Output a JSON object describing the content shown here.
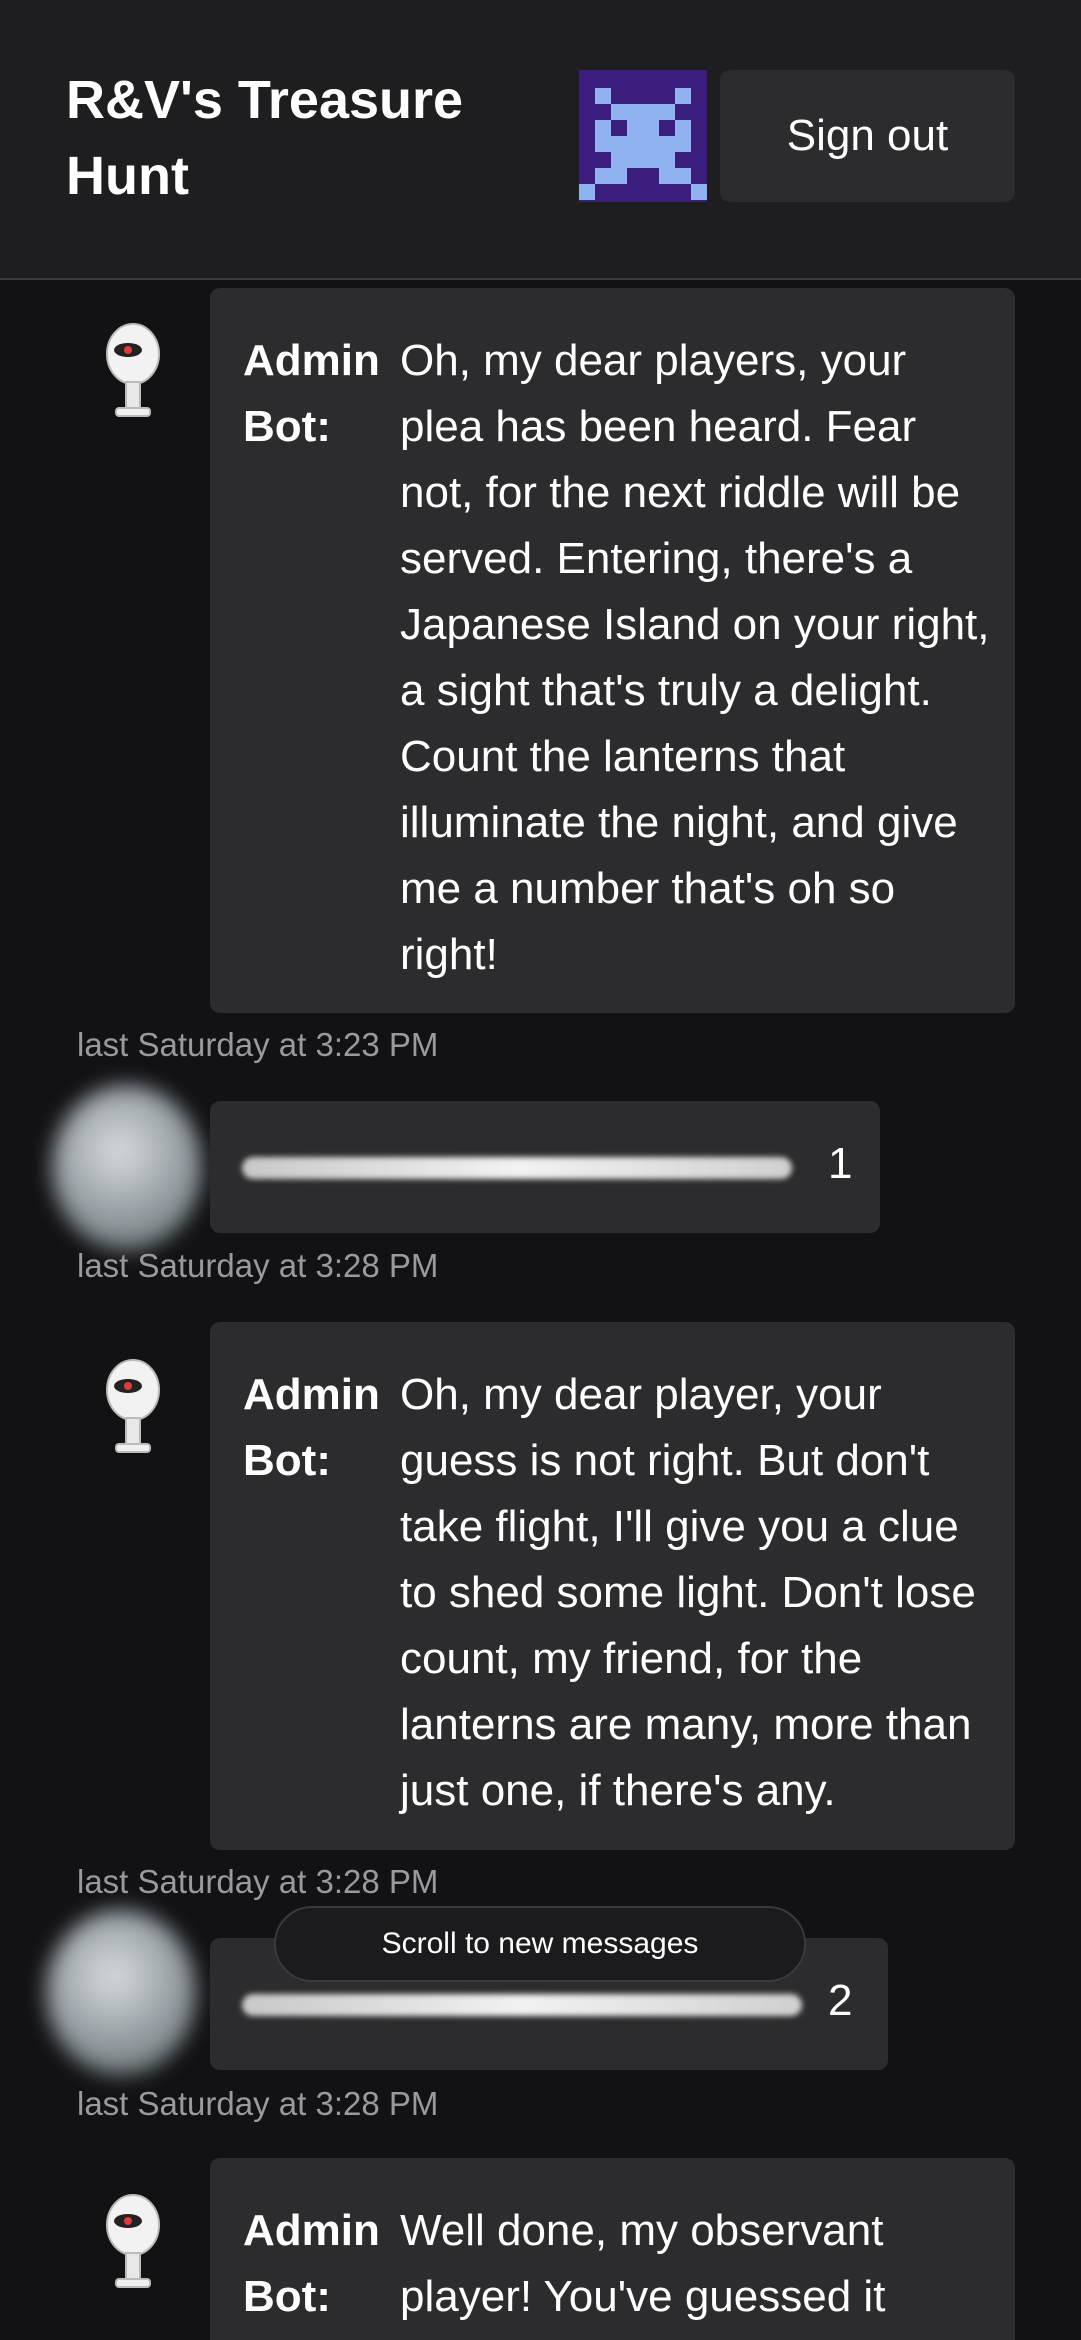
{
  "header": {
    "title": "R&V's Treasure Hunt",
    "signout_label": "Sign out"
  },
  "messages": [
    {
      "sender": "Admin Bot:",
      "text": "Oh, my dear players, your plea has been heard. Fear not, for the next riddle will be served. Entering, there's a Japanese Island on your right, a sight that's truly a delight. Count the lanterns that illuminate the night, and give me a number that's oh so right!",
      "timestamp": "last Saturday at 3:23 PM"
    },
    {
      "answer": "1",
      "timestamp": "last Saturday at 3:28 PM"
    },
    {
      "sender": "Admin Bot:",
      "text": "Oh, my dear player, your guess is not right. But don't take flight, I'll give you a clue to shed some light. Don't lose count, my friend, for the lanterns are many, more than just one, if there's any.",
      "timestamp": "last Saturday at 3:28 PM"
    },
    {
      "answer": "2",
      "timestamp": "last Saturday at 3:28 PM"
    },
    {
      "sender": "Admin Bot:",
      "text": "Well done, my observant player! You've guessed it"
    }
  ],
  "scroll_pill": "Scroll to new messages",
  "icons": {
    "avatar": "pixel-invader-icon",
    "bot": "robot-avatar-icon"
  },
  "colors": {
    "background": "#121214",
    "header": "#1e1e20",
    "bubble": "#2c2c2e",
    "sprite_bg": "#3b1d7e",
    "sprite_fg": "#8fb3f0"
  }
}
